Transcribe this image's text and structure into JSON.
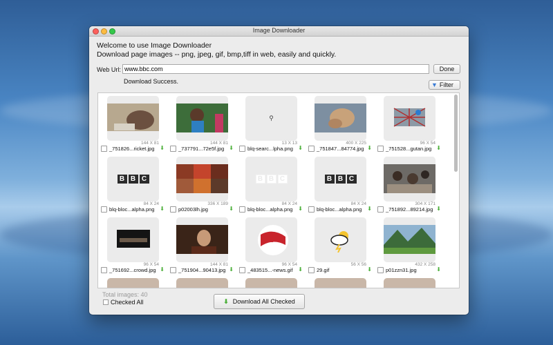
{
  "window": {
    "title": "Image Downloader",
    "welcome_line1": "Welcome to use Image Downloader",
    "welcome_line2": "Download page images -- png, jpeg, gif, bmp,tiff in web, easily and quickly."
  },
  "url": {
    "label": "Web Url:",
    "value": "www.bbc.com",
    "done_label": "Done"
  },
  "status": {
    "text": "Download Success.",
    "filter_label": "Filter"
  },
  "images": [
    {
      "name": "_751826...ricket.jpg",
      "dims": "144 X 81",
      "thumb": "photo-cricket"
    },
    {
      "name": "_737791...72e5f.jpg",
      "dims": "144 X 81",
      "thumb": "photo-crowd"
    },
    {
      "name": "blq-searc...lpha.png",
      "dims": "13 X 13",
      "thumb": "search-icon"
    },
    {
      "name": "_751847...84774.jpg",
      "dims": "400 X 225",
      "thumb": "photo-smoke"
    },
    {
      "name": "_751528...gutan.jpg",
      "dims": "96 X 54",
      "thumb": "photo-net"
    },
    {
      "name": "blq-bloc...alpha.png",
      "dims": "84 X 24",
      "thumb": "bbc-dark"
    },
    {
      "name": "p02003lh.jpg",
      "dims": "336 X 189",
      "thumb": "photo-collage"
    },
    {
      "name": "blq-bloc...alpha.png",
      "dims": "84 X 24",
      "thumb": "bbc-light"
    },
    {
      "name": "blq-bloc...alpha.png",
      "dims": "84 X 24",
      "thumb": "bbc-dark"
    },
    {
      "name": "_751892...89214.jpg",
      "dims": "304 X 171",
      "thumb": "photo-people"
    },
    {
      "name": "_751692...crowd.jpg",
      "dims": "96 X 54",
      "thumb": "photo-stage"
    },
    {
      "name": "_751904...90413.jpg",
      "dims": "144 X 81",
      "thumb": "photo-portrait"
    },
    {
      "name": "_483515...-news.gif",
      "dims": "96 X 54",
      "thumb": "photo-news"
    },
    {
      "name": "29.gif",
      "dims": "56 X 56",
      "thumb": "weather-icon"
    },
    {
      "name": "p01zzn31.jpg",
      "dims": "432 X 258",
      "thumb": "photo-valley"
    }
  ],
  "footer": {
    "total": "Total images: 40",
    "checked_all": "Checked All",
    "download_all": "Download All  Checked"
  }
}
